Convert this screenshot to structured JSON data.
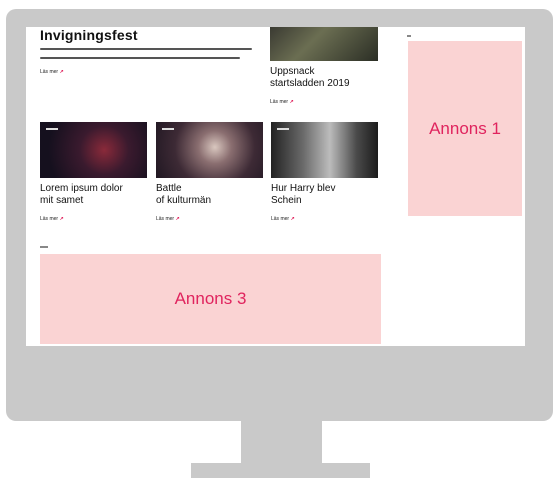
{
  "hero": {
    "title": "Invigningsfest",
    "read_more": "Läs mer"
  },
  "top_right_card": {
    "title_line1": "Uppsnack",
    "title_line2": "startsladden 2019",
    "read_more": "Läs mer"
  },
  "cards": [
    {
      "title_line1": "Lorem ipsum dolor",
      "title_line2": "mit samet",
      "read_more": "Läs mer"
    },
    {
      "title_line1": "Battle",
      "title_line2": "of kulturmän",
      "read_more": "Läs mer"
    },
    {
      "title_line1": "Hur Harry blev",
      "title_line2": "Schein",
      "read_more": "Läs mer"
    }
  ],
  "ads": {
    "ad1": "Annons 1",
    "ad3": "Annons 3"
  },
  "colors": {
    "accent": "#e0245e",
    "ad_background": "#fad3d3",
    "monitor": "#c9c9c9"
  }
}
